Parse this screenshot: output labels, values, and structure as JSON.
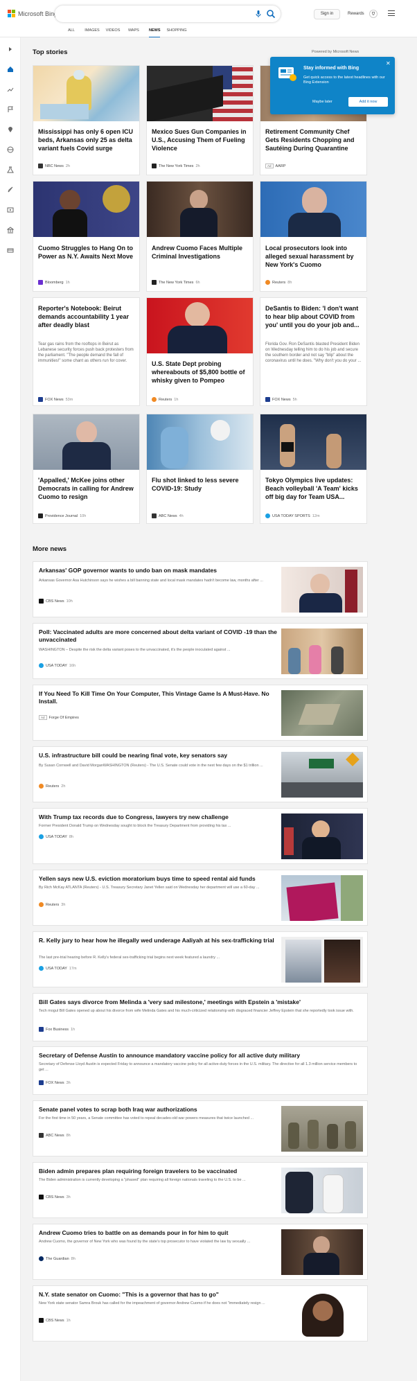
{
  "header": {
    "logo_text": "Microsoft Bing",
    "search_placeholder": "",
    "nav": [
      {
        "label": "ALL"
      },
      {
        "label": "IMAGES"
      },
      {
        "label": "VIDEOS"
      },
      {
        "label": "MAPS"
      },
      {
        "label": "NEWS"
      },
      {
        "label": "SHOPPING"
      }
    ],
    "active_nav": "NEWS",
    "signin": "Sign in",
    "rewards": "Rewards"
  },
  "colors": {
    "accent": "#0f6cbd",
    "promo_bg": "#0f84c8"
  },
  "top_stories": {
    "heading": "Top stories",
    "powered_by": "Powered by Microsoft News",
    "cards": [
      {
        "title": "Mississippi has only 6 open ICU beds, Arkansas only 25 as delta variant fuels Covid surge",
        "source": "NBC News",
        "time": "2h",
        "snippet": ""
      },
      {
        "title": "Mexico Sues Gun Companies in U.S., Accusing Them of Fueling Violence",
        "source": "The New York Times",
        "time": "2h",
        "snippet": ""
      },
      {
        "title": "Retirement Community Chef Gets Residents Chopping and Sautéing During Quarantine",
        "source": "AARP",
        "time": "",
        "snippet": "",
        "ad": "Ad"
      },
      {
        "title": "Cuomo Struggles to Hang On to Power as N.Y. Awaits Next Move",
        "source": "Bloomberg",
        "time": "1h",
        "snippet": ""
      },
      {
        "title": "Andrew Cuomo Faces Multiple Criminal Investigations",
        "source": "The New York Times",
        "time": "6h",
        "snippet": ""
      },
      {
        "title": "Local prosecutors look into alleged sexual harassment by New York's Cuomo",
        "source": "Reuters",
        "time": "8h",
        "snippet": ""
      },
      {
        "title": "Reporter's Notebook: Beirut demands accountability 1 year after deadly blast",
        "source": "FOX News",
        "time": "53m",
        "snippet": "Tear gas rains from the rooftops in Beirut as Lebanese security forces push back protesters from the parliament. \"The people demand the fall of immunities!\" some chant as others run for cover."
      },
      {
        "title": "U.S. State Dept probing whereabouts of $5,800 bottle of whisky given to Pompeo",
        "source": "Reuters",
        "time": "1h",
        "snippet": ""
      },
      {
        "title": "DeSantis to Biden: 'I don't want to hear blip about COVID from you' until you do your job and...",
        "source": "FOX News",
        "time": "5h",
        "snippet": "Florida Gov. Ron DeSantis blasted President Biden on Wednesday telling him to do his job and secure the southern border and not say \"blip\" about the coronavirus until he does. \"Why don't you do your ..."
      },
      {
        "title": "'Appalled,' McKee joins other Democrats in calling for Andrew Cuomo to resign",
        "source": "Providence Journal",
        "time": "10h",
        "snippet": ""
      },
      {
        "title": "Flu shot linked to less severe COVID-19: Study",
        "source": "ABC News",
        "time": "4h",
        "snippet": ""
      },
      {
        "title": "Tokyo Olympics live updates: Beach volleyball 'A Team' kicks off big day for Team USA...",
        "source": "USA TODAY SPORTS",
        "time": "12m",
        "snippet": ""
      }
    ]
  },
  "promo": {
    "title": "Stay informed with Bing",
    "body": "Get quick access to the latest headlines with our Bing Extension",
    "later": "Maybe later",
    "add": "Add it now"
  },
  "more_news": {
    "heading": "More news",
    "items": [
      {
        "title": "Arkansas' GOP governor wants to undo ban on mask mandates",
        "snippet": "Arkansas Governor Asa Hutchinson says he wishes a bill banning state and local mask mandates hadn't become law, months after ...",
        "source": "CBS News",
        "time": "10h"
      },
      {
        "title": "Poll: Vaccinated adults are more concerned about delta variant of COVID -19 than the unvaccinated",
        "snippet": "WASHINGTON – Despite the risk the delta variant poses to the unvaccinated, it's the people inoculated against ...",
        "source": "USA TODAY",
        "time": "16h"
      },
      {
        "title": "If You Need To Kill Time On Your Computer, This Vintage Game Is A Must-Have. No Install.",
        "snippet": "",
        "source": "Forge Of Empires",
        "time": "",
        "ad": "Ad"
      },
      {
        "title": "U.S. infrastructure bill could be nearing final vote, key senators say",
        "snippet": "By Susan Cornwell and David MorganWASHINGTON (Reuters) - The U.S. Senate could vote in the next few days on the $1 trillion ...",
        "source": "Reuters",
        "time": "2h"
      },
      {
        "title": "With Trump tax records due to Congress, lawyers try new challenge",
        "snippet": "Former President Donald Trump on Wednesday sought to block the Treasury Department from providing his tax ...",
        "source": "USA TODAY",
        "time": "8h"
      },
      {
        "title": "Yellen says new U.S. eviction moratorium buys time to speed rental aid funds",
        "snippet": "By Rich McKay ATLANTA (Reuters) - U.S. Treasury Secretary Janet Yellen said on Wednesday her department will use a 60-day ...",
        "source": "Reuters",
        "time": "3h"
      },
      {
        "title": "R. Kelly jury to hear how he illegally wed underage Aaliyah at his sex-trafficking trial",
        "snippet": "The last pre-trial hearing before R. Kelly's federal sex-trafficking trial begins next week featured a laundry ...",
        "source": "USA TODAY",
        "time": "17m"
      },
      {
        "title": "Bill Gates says divorce from Melinda a 'very sad milestone,' meetings with Epstein a 'mistake'",
        "snippet": "Tech mogul Bill Gates opened up about his divorce from wife Melinda Gates and his much-criticized relationship with disgraced financier Jeffrey Epstein that she reportedly took issue with.",
        "source": "Fox Business",
        "time": "1h"
      },
      {
        "title": "Secretary of Defense Austin to announce mandatory vaccine policy for all active duty military",
        "snippet": "Secretary of Defense Lloyd Austin is expected Friday to announce a mandatory vaccine policy for all active-duty forces in the U.S. military. The directive for all 1.3 million service members to get ...",
        "source": "FOX News",
        "time": "3h"
      },
      {
        "title": "Senate panel votes to scrap both Iraq war authorizations",
        "snippet": "For the first time in 50 years, a Senate committee has voted to repeal decades-old war powers measures that twice launched ...",
        "source": "ABC News",
        "time": "8h"
      },
      {
        "title": "Biden admin prepares plan requiring foreign travelers to be vaccinated",
        "snippet": "The Biden administration is currently developing a \"phased\" plan requiring all foreign nationals traveling to the U.S. to be ...",
        "source": "CBS News",
        "time": "3h"
      },
      {
        "title": "Andrew Cuomo tries to battle on as demands pour in for him to quit",
        "snippet": "Andrew Cuomo, the governor of New York who was found by the state's top prosecutor to have violated the law by sexually ...",
        "source": "The Guardian",
        "time": "8h"
      },
      {
        "title": "N.Y. state senator on Cuomo: \"This is a governor that has to go\"",
        "snippet": "New York state senator Samra Brouk has called for the impeachment of governor Andrew Cuomo if he does not \"immediately resign ...",
        "source": "CBS News",
        "time": "1h"
      }
    ]
  }
}
